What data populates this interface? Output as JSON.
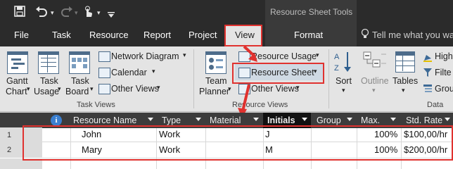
{
  "title_bar": {
    "context_title": "Resource Sheet Tools"
  },
  "tabs": [
    "File",
    "Task",
    "Resource",
    "Report",
    "Project",
    "View",
    "Format"
  ],
  "tell_me": "Tell me what you wa",
  "ribbon": {
    "task_views": {
      "gantt": [
        "Gantt",
        "Chart"
      ],
      "task_usage": [
        "Task",
        "Usage"
      ],
      "task_board": [
        "Task",
        "Board"
      ],
      "network_diagram": "Network Diagram",
      "calendar": "Calendar",
      "other_views": "Other Views",
      "group_label": "Task Views"
    },
    "resource_views": {
      "team_planner": [
        "Team",
        "Planner"
      ],
      "resource_usage": "Resource Usage",
      "resource_sheet": "Resource Sheet",
      "other_views": "Other Views",
      "group_label": "Resource Views"
    },
    "data": {
      "sort": "Sort",
      "outline": "Outline",
      "tables": "Tables",
      "highlight": "High",
      "filter": "Filte",
      "group": "Grou",
      "group_label": "Data"
    }
  },
  "sheet": {
    "columns": [
      "Resource Name",
      "Type",
      "Material",
      "Initials",
      "Group",
      "Max.",
      "Std. Rate"
    ],
    "rows": [
      {
        "id": "1",
        "name": "John",
        "type": "Work",
        "material": "",
        "initials": "J",
        "group": "",
        "max": "100%",
        "rate": "$100,00/hr"
      },
      {
        "id": "2",
        "name": "Mary",
        "type": "Work",
        "material": "",
        "initials": "M",
        "group": "",
        "max": "100%",
        "rate": "$200,00/hr"
      }
    ]
  }
}
